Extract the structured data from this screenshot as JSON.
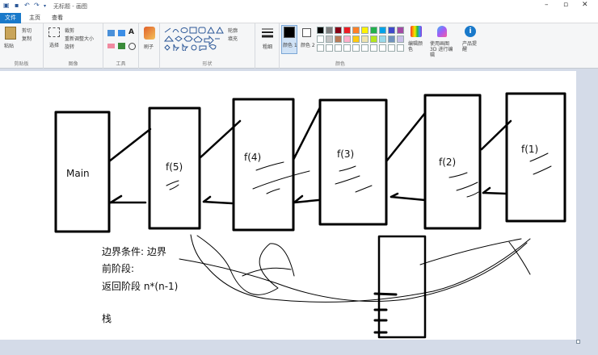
{
  "window": {
    "title": "无标题 - 画图",
    "minimize_icon": "minimize-icon",
    "maximize_icon": "maximize-icon",
    "close_icon": "close-icon"
  },
  "tabs": [
    {
      "label": "文件"
    },
    {
      "label": "主页"
    },
    {
      "label": "查看"
    }
  ],
  "ribbon": {
    "clipboard": {
      "paste_label": "粘贴",
      "cut_label": "剪切",
      "copy_label": "复制",
      "group_label": "剪贴板"
    },
    "image": {
      "select_label": "选择",
      "crop_label": "裁剪",
      "resize_label": "重新调整大小",
      "rotate_label": "旋转",
      "group_label": "图像"
    },
    "tools": {
      "group_label": "工具",
      "text_glyph": "A"
    },
    "brushes": {
      "label": "刷子"
    },
    "shapes": {
      "outline_label": "轮廓",
      "fill_label": "填充",
      "group_label": "形状"
    },
    "size": {
      "label": "粗细"
    },
    "colors": {
      "color1_label": "颜色 1",
      "color2_label": "颜色 2",
      "edit_label": "编辑颜色",
      "paint3d_label": "使用画图 3D 进行编辑",
      "alert_label": "产品提醒",
      "group_label": "颜色",
      "color1_value": "#000000",
      "color2_value": "#ffffff",
      "palette": [
        "#000000",
        "#7f7f7f",
        "#880015",
        "#ed1c24",
        "#ff7f27",
        "#fff200",
        "#22b14c",
        "#00a2e8",
        "#3f48cc",
        "#a349a4",
        "#ffffff",
        "#c3c3c3",
        "#b97a57",
        "#ffaec9",
        "#ffc90e",
        "#efe4b0",
        "#b5e61d",
        "#99d9ea",
        "#7092be",
        "#c8bfe7",
        "#ffffff",
        "#ffffff",
        "#ffffff",
        "#ffffff",
        "#ffffff",
        "#ffffff",
        "#ffffff",
        "#ffffff",
        "#ffffff",
        "#ffffff"
      ]
    }
  },
  "canvas": {
    "main_label": "Main",
    "frames": [
      {
        "label": "f(5)"
      },
      {
        "label": "f(4)"
      },
      {
        "label": "f(3)"
      },
      {
        "label": "f(2)"
      },
      {
        "label": "f(1)"
      }
    ],
    "notes": {
      "boundary": "边界条件: 边界",
      "forward": "前阶段:",
      "return": "返回阶段  n*(n-1)",
      "stack": "栈"
    }
  }
}
